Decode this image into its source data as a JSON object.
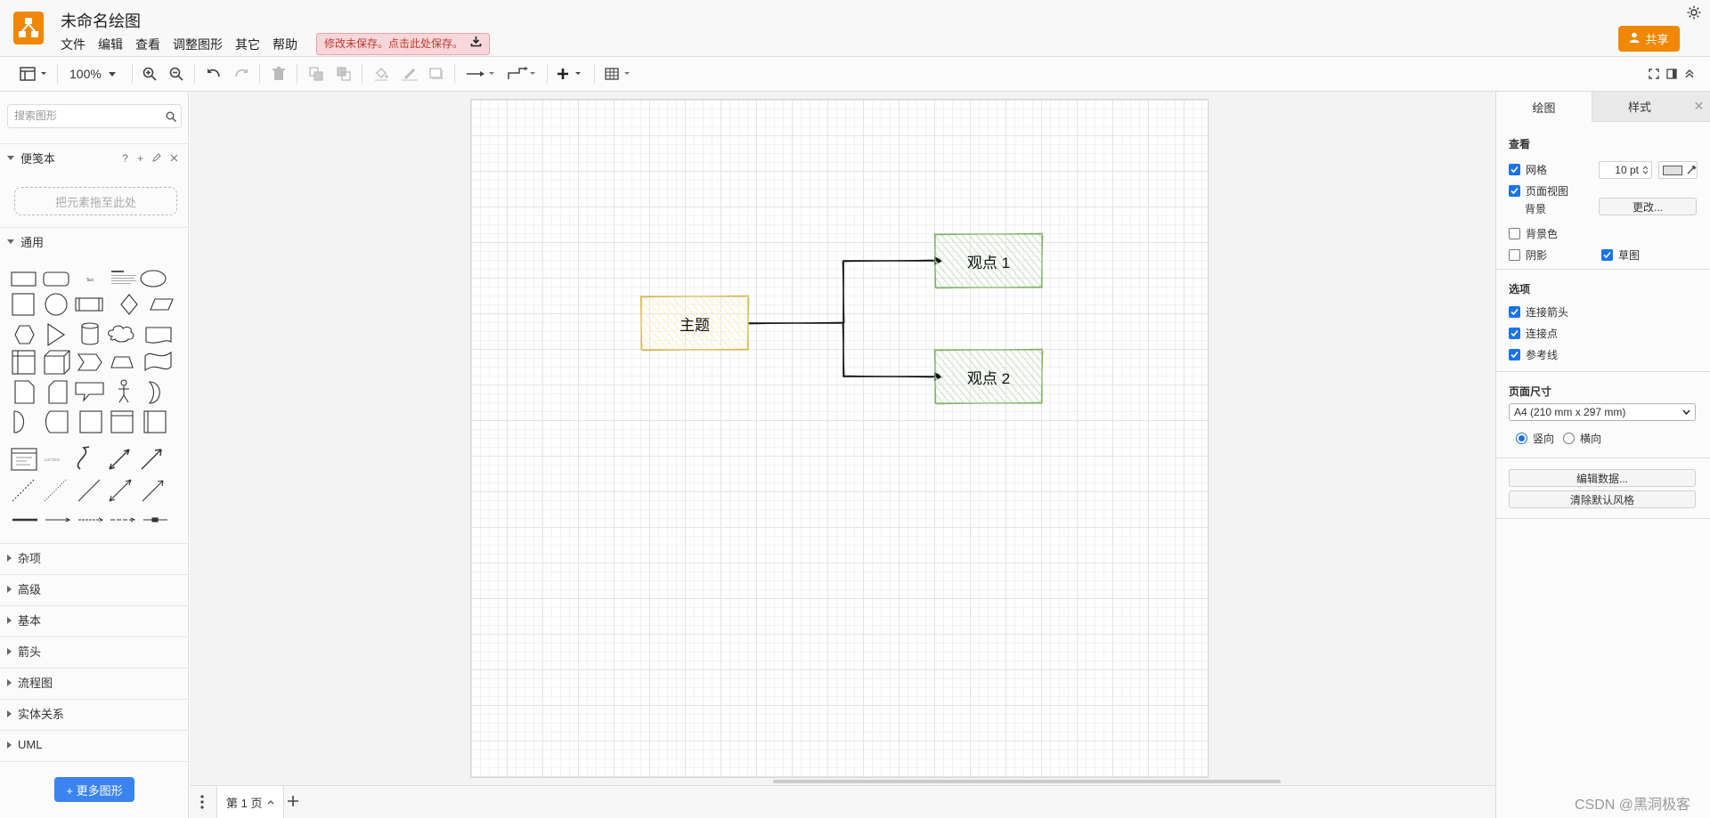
{
  "app": {
    "title": "未命名绘图",
    "menus": [
      "文件",
      "编辑",
      "查看",
      "调整图形",
      "其它",
      "帮助"
    ],
    "unsaved_notice": "修改未保存。点击此处保存。",
    "share_label": "共享",
    "brand_color": "#f08705"
  },
  "toolbar": {
    "zoom": "100%"
  },
  "sidebar": {
    "search_placeholder": "搜索图形",
    "scratchpad": {
      "title": "便笺本",
      "tools": [
        "?",
        "+"
      ],
      "dropzone": "把元素拖至此处"
    },
    "general_title": "通用",
    "sections": [
      "杂项",
      "高级",
      "基本",
      "箭头",
      "流程图",
      "实体关系",
      "UML"
    ],
    "more_shapes": "+ 更多图形"
  },
  "diagram": {
    "topic": {
      "label": "主题",
      "fill": "#fff2cc",
      "stroke": "#d6b656"
    },
    "points": [
      {
        "label": "观点 1",
        "fill": "#d5e8d4",
        "stroke": "#82b366"
      },
      {
        "label": "观点 2",
        "fill": "#d5e8d4",
        "stroke": "#82b366"
      }
    ]
  },
  "pages": {
    "tab_label": "第 1 页"
  },
  "panel": {
    "tabs": [
      "绘图",
      "样式"
    ],
    "view": {
      "title": "查看",
      "grid_label": "网格",
      "grid_checked": true,
      "grid_size": "10 pt",
      "page_view_label": "页面视图",
      "page_view_checked": true,
      "background_label": "背景",
      "change_button": "更改...",
      "bg_color_label": "背景色",
      "bg_color_checked": false,
      "shadow_label": "阴影",
      "shadow_checked": false,
      "sketch_label": "草图",
      "sketch_checked": true
    },
    "options": {
      "title": "选项",
      "items": [
        {
          "label": "连接箭头",
          "checked": true
        },
        {
          "label": "连接点",
          "checked": true
        },
        {
          "label": "参考线",
          "checked": true
        }
      ]
    },
    "page_size": {
      "title": "页面尺寸",
      "selected": "A4 (210 mm x 297 mm)",
      "portrait": "竖向",
      "landscape": "横向",
      "orientation": "portrait"
    },
    "edit_data": "编辑数据...",
    "clear_style": "清除默认风格"
  },
  "watermark": "CSDN @黑洞极客"
}
